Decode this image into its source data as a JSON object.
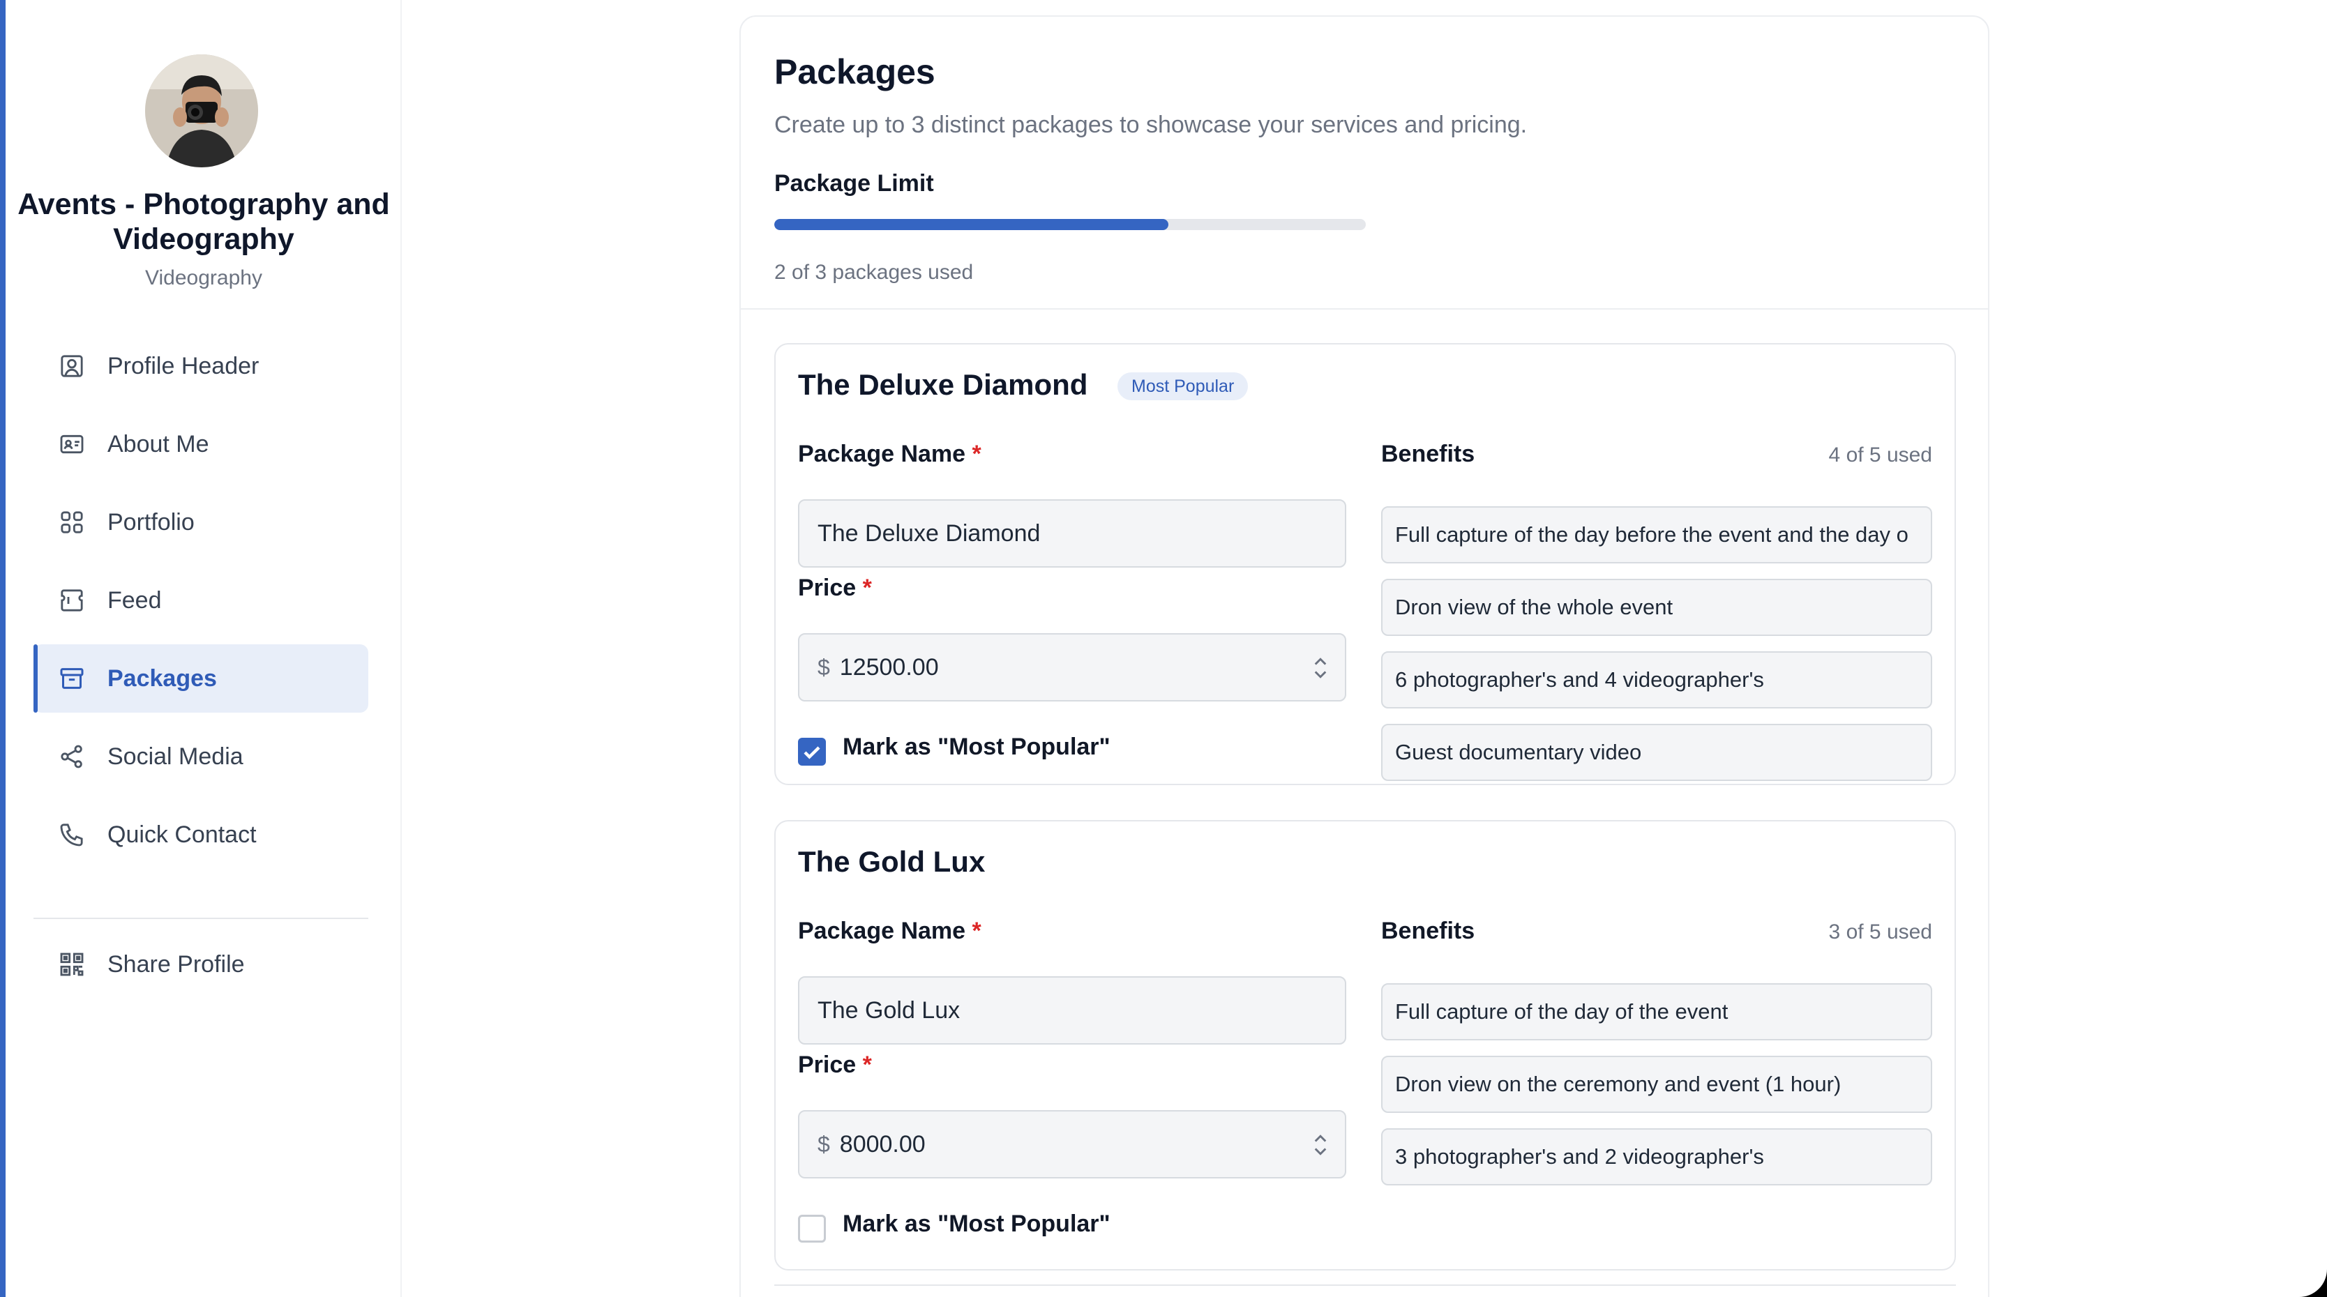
{
  "profile": {
    "name": "Avents - Photography and Videography",
    "category": "Videography"
  },
  "nav": {
    "items": [
      {
        "label": "Profile Header",
        "icon": "user-square-icon"
      },
      {
        "label": "About Me",
        "icon": "id-card-icon"
      },
      {
        "label": "Portfolio",
        "icon": "grid-icon"
      },
      {
        "label": "Feed",
        "icon": "feed-icon"
      },
      {
        "label": "Packages",
        "icon": "archive-box-icon",
        "active": true
      },
      {
        "label": "Social Media",
        "icon": "share-nodes-icon"
      },
      {
        "label": "Quick Contact",
        "icon": "phone-icon"
      }
    ],
    "share": {
      "label": "Share Profile",
      "icon": "qr-code-icon"
    }
  },
  "packages_page": {
    "title": "Packages",
    "description": "Create up to 3 distinct packages to showcase your services and pricing.",
    "limit_label": "Package Limit",
    "limit_text": "2 of 3 packages used",
    "used": 2,
    "max": 3
  },
  "packages": [
    {
      "title": "The Deluxe Diamond",
      "badge": "Most Popular",
      "name_label": "Package Name",
      "name_value": "The Deluxe Diamond",
      "price_label": "Price",
      "currency": "$",
      "price_value": "12500.00",
      "most_popular_label": "Mark as \"Most Popular\"",
      "most_popular": true,
      "benefits_label": "Benefits",
      "benefits_count": "4 of 5 used",
      "benefits": [
        "Full capture of the day before the event and the day o",
        "Dron view of the whole event",
        "6 photographer's and 4 videographer's",
        "Guest documentary video"
      ]
    },
    {
      "title": "The Gold Lux",
      "name_label": "Package Name",
      "name_value": "The Gold Lux",
      "price_label": "Price",
      "currency": "$",
      "price_value": "8000.00",
      "most_popular_label": "Mark as \"Most Popular\"",
      "most_popular": false,
      "benefits_label": "Benefits",
      "benefits_count": "3 of 5 used",
      "benefits": [
        "Full capture of the day of the event",
        "Dron view on the ceremony and event (1 hour)",
        "3 photographer's and 2 videographer's"
      ]
    }
  ],
  "colors": {
    "accent": "#3565c2",
    "active_bg": "#e8eef9",
    "required": "#dc2626"
  }
}
